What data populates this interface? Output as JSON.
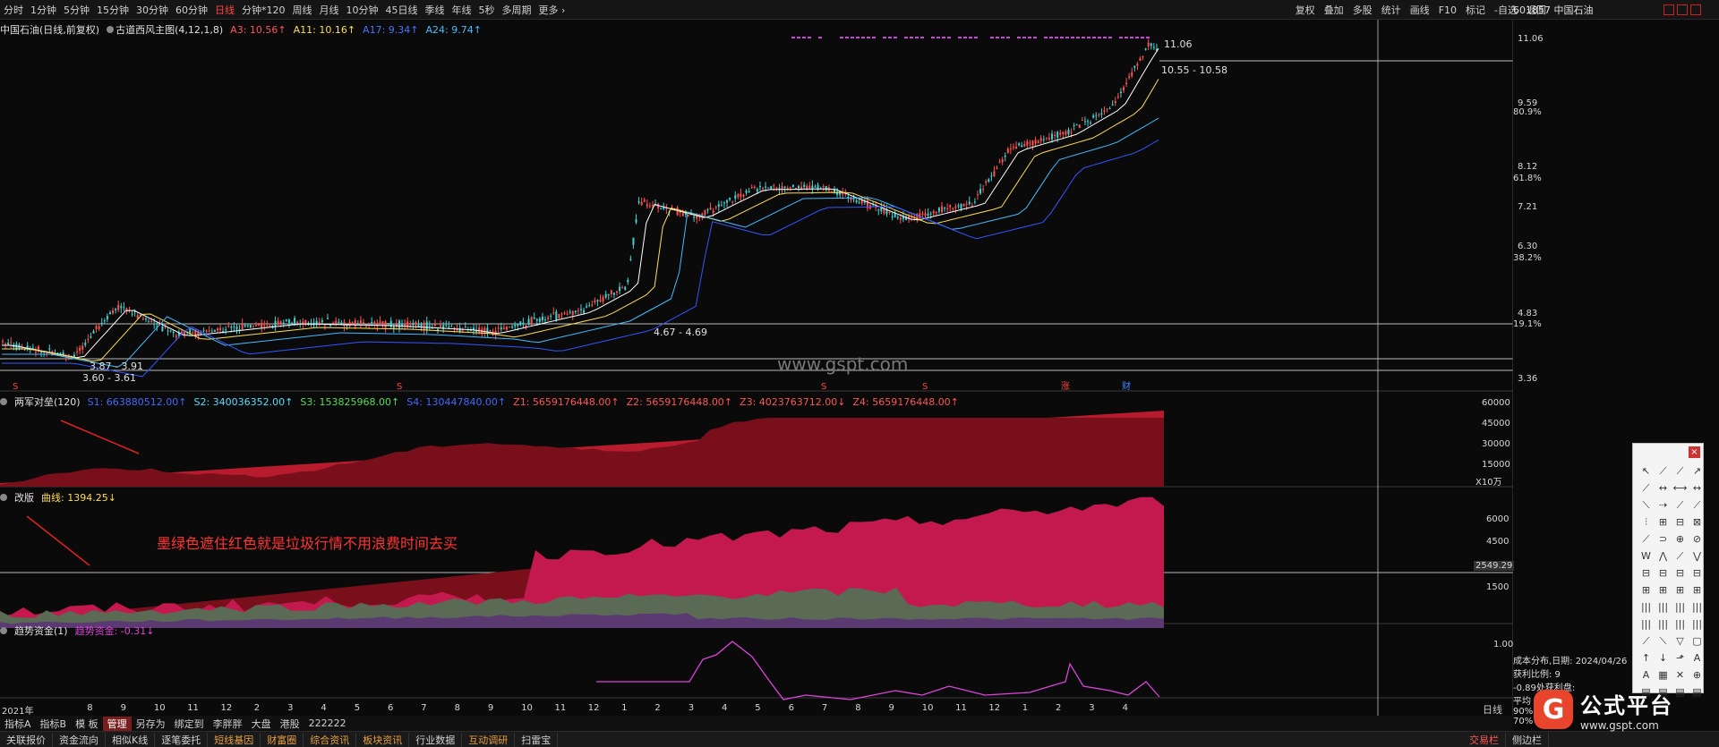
{
  "toolbar": {
    "periods": [
      "分时",
      "1分钟",
      "5分钟",
      "15分钟",
      "30分钟",
      "60分钟",
      "日线",
      "分钟*120",
      "周线",
      "月线",
      "10分钟",
      "45日线",
      "季线",
      "年线",
      "5秒",
      "多周期",
      "更多 ›"
    ],
    "active_period": "日线",
    "right_items": [
      "复权",
      "叠加",
      "多股",
      "统计",
      "画线",
      "F10",
      "标记",
      "-自选",
      "返回"
    ],
    "stock_code": "601857",
    "stock_name": "中国石油"
  },
  "main_chart": {
    "title": "中国石油(日线,前复权)",
    "indicator": "古道西风主图(4,12,1,8)",
    "ma_values": [
      {
        "label": "A3: 10.56↑",
        "color": "#ff5555"
      },
      {
        "label": "A11: 10.16↑",
        "color": "#ffdd55"
      },
      {
        "label": "A17: 9.34↑",
        "color": "#4477ff"
      },
      {
        "label": "A24: 9.74↑",
        "color": "#44bbff"
      }
    ],
    "price_labels": [
      "11.06",
      "9.59",
      "8.12",
      "7.21",
      "6.30",
      "4.83",
      "3.36"
    ],
    "pct_labels": [
      "80.9%",
      "61.8%",
      "38.2%",
      "19.1%"
    ],
    "annotations": [
      "11.06",
      "10.55 - 10.58",
      "4.67 - 4.69",
      "3.87 - 3.91",
      "3.60 - 3.61"
    ],
    "watermark": "www.gspt.com",
    "markers": [
      "S",
      "S",
      "S",
      "S",
      "涨",
      "财"
    ]
  },
  "panel1": {
    "name": "两军对垒(120)",
    "values": [
      {
        "label": "S1: 663880512.00↑",
        "color": "#4466ff"
      },
      {
        "label": "S2: 340036352.00↑",
        "color": "#55ddff"
      },
      {
        "label": "S3: 153825968.00↑",
        "color": "#55dd55"
      },
      {
        "label": "S4: 130447840.00↑",
        "color": "#4466ff"
      },
      {
        "label": "Z1: 5659176448.00↑",
        "color": "#ff5555"
      },
      {
        "label": "Z2: 5659176448.00↑",
        "color": "#ff5555"
      },
      {
        "label": "Z3: 4023763712.00↓",
        "color": "#ff5555"
      },
      {
        "label": "Z4: 5659176448.00↑",
        "color": "#ff5555"
      }
    ],
    "axis": [
      "60000",
      "45000",
      "30000",
      "15000"
    ],
    "unit": "X10万"
  },
  "panel2": {
    "name": "改版",
    "curve_label": "曲线: 1394.25↓",
    "annotation": "墨绿色遮住红色就是垃圾行情不用浪费时间去买",
    "axis": [
      "6000",
      "4500",
      "1500"
    ],
    "crosshair_value": "2549.29"
  },
  "panel3": {
    "name": "趋势资金(1)",
    "value_label": "趋势资金: -0.31↓",
    "axis": [
      "1.00"
    ]
  },
  "time_axis": [
    "2021年",
    "8",
    "9",
    "10",
    "11",
    "12",
    "2",
    "3",
    "4",
    "5",
    "6",
    "7",
    "8",
    "9",
    "10",
    "11",
    "12",
    "1",
    "2",
    "3",
    "4",
    "5",
    "6",
    "7",
    "8",
    "9",
    "10",
    "11",
    "12",
    "1",
    "2",
    "3",
    "4"
  ],
  "time_right": "日线",
  "bottom_tabs": [
    "指标A",
    "指标B",
    "模 板",
    "管理",
    "另存为",
    "绑定到",
    "李胖胖",
    "大盘",
    "港股",
    "222222"
  ],
  "active_tab": "管理",
  "status_bar": [
    "关联报价",
    "资金流向",
    "相似K线",
    "逐笔委托",
    "短线基因",
    "财富圈",
    "综合资讯",
    "板块资讯",
    "行业数据",
    "互动调研",
    "扫雷宝"
  ],
  "status_accent": [
    "短线基因",
    "财富圈",
    "综合资讯",
    "板块资讯",
    "互动调研"
  ],
  "status_right": [
    "交易栏",
    "侧边栏"
  ],
  "cost_panel": {
    "date_line": "成本分布,日期: 2024/04/26",
    "profit_line": "获利比例: 9",
    "loss_line": "-0.89处获利盘:",
    "avg_line": "平均",
    "l1": "90%",
    "l2": "70%"
  },
  "brand": {
    "name": "公式平台",
    "url": "www.gspt.com",
    "logo": "G"
  }
}
